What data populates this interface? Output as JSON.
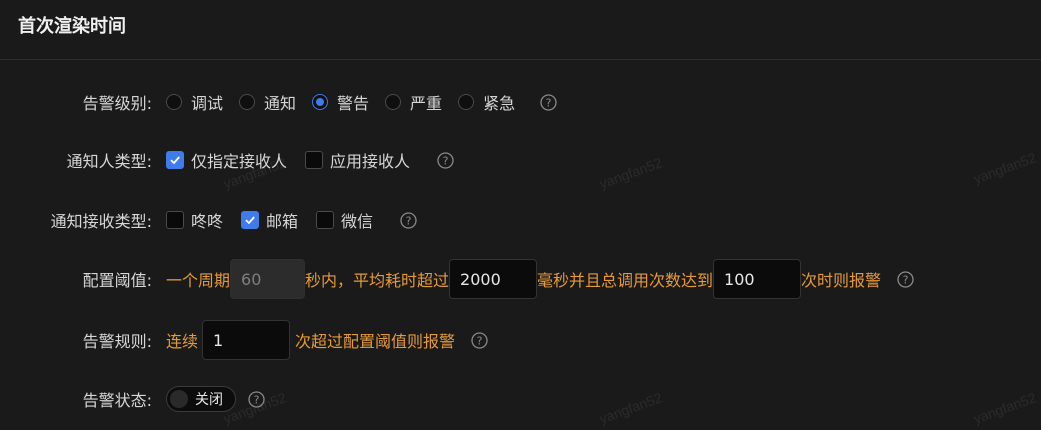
{
  "page": {
    "title": "首次渲染时间"
  },
  "watermark": "yangfan52",
  "alert_level": {
    "label": "告警级别:",
    "options": [
      "调试",
      "通知",
      "警告",
      "严重",
      "紧急"
    ],
    "selected_index": 2
  },
  "notifier_type": {
    "label": "通知人类型:",
    "options": [
      {
        "text": "仅指定接收人",
        "checked": true
      },
      {
        "text": "应用接收人",
        "checked": false
      }
    ]
  },
  "receive_type": {
    "label": "通知接收类型:",
    "options": [
      {
        "text": "咚咚",
        "checked": false
      },
      {
        "text": "邮箱",
        "checked": true
      },
      {
        "text": "微信",
        "checked": false
      }
    ]
  },
  "threshold": {
    "label": "配置阈值:",
    "text_1": "一个周期",
    "period_value": "60",
    "text_2": "秒内，平均耗时超过",
    "time_value": "2000",
    "text_3": "毫秒并且总调用次数达到",
    "count_value": "100",
    "text_4": "次时则报警"
  },
  "rule": {
    "label": "告警规则:",
    "prefix": "连续",
    "value": "1",
    "suffix": "次超过配置阈值则报警"
  },
  "status": {
    "label": "告警状态:",
    "switch_text": "关闭"
  },
  "colors": {
    "accent": "#3f7bea",
    "warning_text": "#e59a3a",
    "background": "#1a1a1a"
  }
}
